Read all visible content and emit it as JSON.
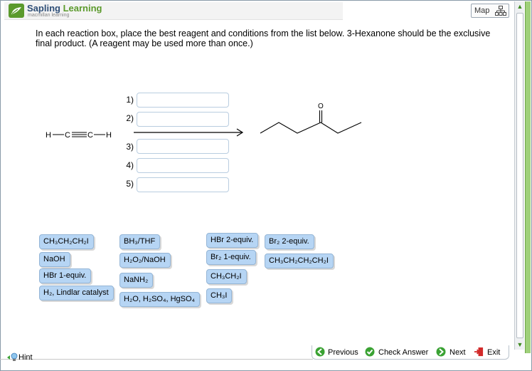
{
  "brand": {
    "name_part1": "Sapling",
    "name_part2": "Learning",
    "tagline": "macmillan learning"
  },
  "toolbar": {
    "map_label": "Map"
  },
  "question": {
    "instructions": "In each reaction box, place the best reagent and conditions from the list below. 3-Hexanone should be the exclusive final product. (A reagent may be used more than once.)",
    "steps": [
      "1)",
      "2)",
      "3)",
      "4)",
      "5)"
    ],
    "reactant": {
      "h_left": "H",
      "c_left": "C",
      "c_right": "C",
      "h_right": "H"
    },
    "product_oxygen": "O"
  },
  "reagents": {
    "r1": "CH₃CH₂CH₂I",
    "r2": "NaOH",
    "r3": "HBr 1-equiv.",
    "r4": "H₂, Lindlar catalyst",
    "r5": "BH₃/THF",
    "r6": "H₂O₂/NaOH",
    "r7": "NaNH₂",
    "r8": "H₂O, H₂SO₄, HgSO₄",
    "r9": "HBr 2-equiv.",
    "r10": "Br₂ 1-equiv.",
    "r11": "CH₃CH₂I",
    "r12": "CH₃I",
    "r13": "Br₂ 2-equiv.",
    "r14": "CH₃CH₂CH₂CH₂I"
  },
  "footer": {
    "hint_label": "Hint",
    "previous_label": "Previous",
    "check_label": "Check Answer",
    "next_label": "Next",
    "exit_label": "Exit"
  },
  "colors": {
    "brand_blue": "#2f4f77",
    "brand_green": "#5b9a2c",
    "reagent_fill": "#b6d5f4",
    "nav_green": "#3aa233"
  }
}
